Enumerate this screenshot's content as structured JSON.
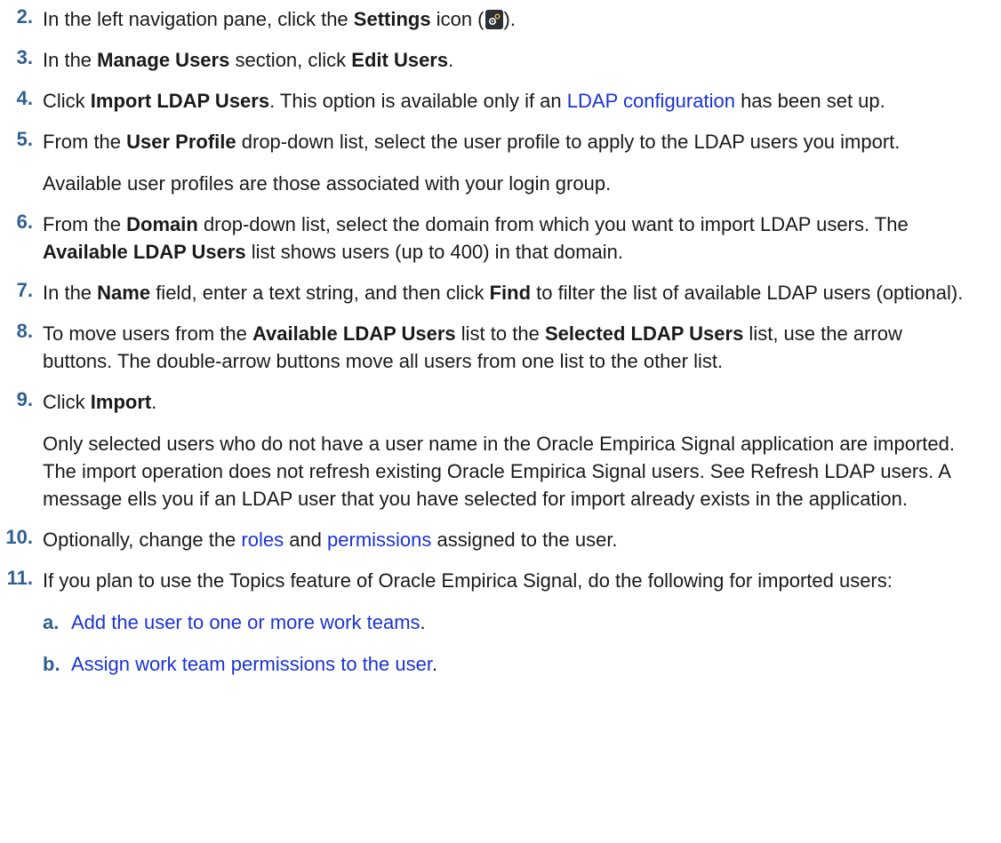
{
  "steps": [
    {
      "number": "2.",
      "paragraphs": [
        [
          {
            "t": "In the left navigation pane, click the "
          },
          {
            "t": "Settings",
            "b": true
          },
          {
            "t": " icon ("
          },
          {
            "icon": "settings-icon"
          },
          {
            "t": ")."
          }
        ]
      ]
    },
    {
      "number": "3.",
      "paragraphs": [
        [
          {
            "t": "In the "
          },
          {
            "t": "Manage Users",
            "b": true
          },
          {
            "t": " section, click "
          },
          {
            "t": "Edit Users",
            "b": true
          },
          {
            "t": "."
          }
        ]
      ]
    },
    {
      "number": "4.",
      "paragraphs": [
        [
          {
            "t": "Click "
          },
          {
            "t": "Import LDAP Users",
            "b": true
          },
          {
            "t": ". This option is available only if an "
          },
          {
            "t": "LDAP configuration",
            "link": true
          },
          {
            "t": " has been set up."
          }
        ]
      ]
    },
    {
      "number": "5.",
      "paragraphs": [
        [
          {
            "t": "From the "
          },
          {
            "t": "User Profile",
            "b": true
          },
          {
            "t": " drop-down list, select the user profile to apply to the LDAP users you import."
          }
        ],
        [
          {
            "t": "Available user profiles are those associated with your login group."
          }
        ]
      ]
    },
    {
      "number": "6.",
      "paragraphs": [
        [
          {
            "t": "From the "
          },
          {
            "t": "Domain",
            "b": true
          },
          {
            "t": " drop-down list, select the domain from which you want to import LDAP users. The "
          },
          {
            "t": "Available LDAP Users",
            "b": true
          },
          {
            "t": " list shows users (up to 400) in that domain."
          }
        ]
      ]
    },
    {
      "number": "7.",
      "paragraphs": [
        [
          {
            "t": "In the "
          },
          {
            "t": "Name",
            "b": true
          },
          {
            "t": " field, enter a text string, and then click "
          },
          {
            "t": "Find",
            "b": true
          },
          {
            "t": " to filter the list of available LDAP users (optional)."
          }
        ]
      ]
    },
    {
      "number": "8.",
      "paragraphs": [
        [
          {
            "t": "To move users from the "
          },
          {
            "t": "Available LDAP Users",
            "b": true
          },
          {
            "t": " list to the "
          },
          {
            "t": "Selected LDAP Users",
            "b": true
          },
          {
            "t": " list, use the arrow buttons. The double-arrow buttons move all users from one list to the other list."
          }
        ]
      ]
    },
    {
      "number": "9.",
      "paragraphs": [
        [
          {
            "t": "Click "
          },
          {
            "t": "Import",
            "b": true
          },
          {
            "t": "."
          }
        ],
        [
          {
            "t": "Only selected users who do not have a user name in the Oracle Empirica Signal application are imported. The import operation does not refresh existing Oracle Empirica Signal users. See Refresh LDAP users. A message ells you if an LDAP user that you have selected for import already exists in the application."
          }
        ]
      ]
    },
    {
      "number": "10.",
      "paragraphs": [
        [
          {
            "t": "Optionally, change the "
          },
          {
            "t": "roles",
            "link": true
          },
          {
            "t": " and "
          },
          {
            "t": "permissions",
            "link": true
          },
          {
            "t": " assigned to the user."
          }
        ]
      ]
    },
    {
      "number": "11.",
      "paragraphs": [
        [
          {
            "t": "If you plan to use the Topics feature of Oracle Empirica Signal, do the following for imported users:"
          }
        ]
      ],
      "substeps": [
        {
          "label": "a.",
          "parts": [
            {
              "t": "Add the user to one or more work teams",
              "link": true
            },
            {
              "t": "."
            }
          ]
        },
        {
          "label": "b.",
          "parts": [
            {
              "t": "Assign work team permissions to the user",
              "link": true
            },
            {
              "t": "."
            }
          ]
        }
      ]
    }
  ]
}
